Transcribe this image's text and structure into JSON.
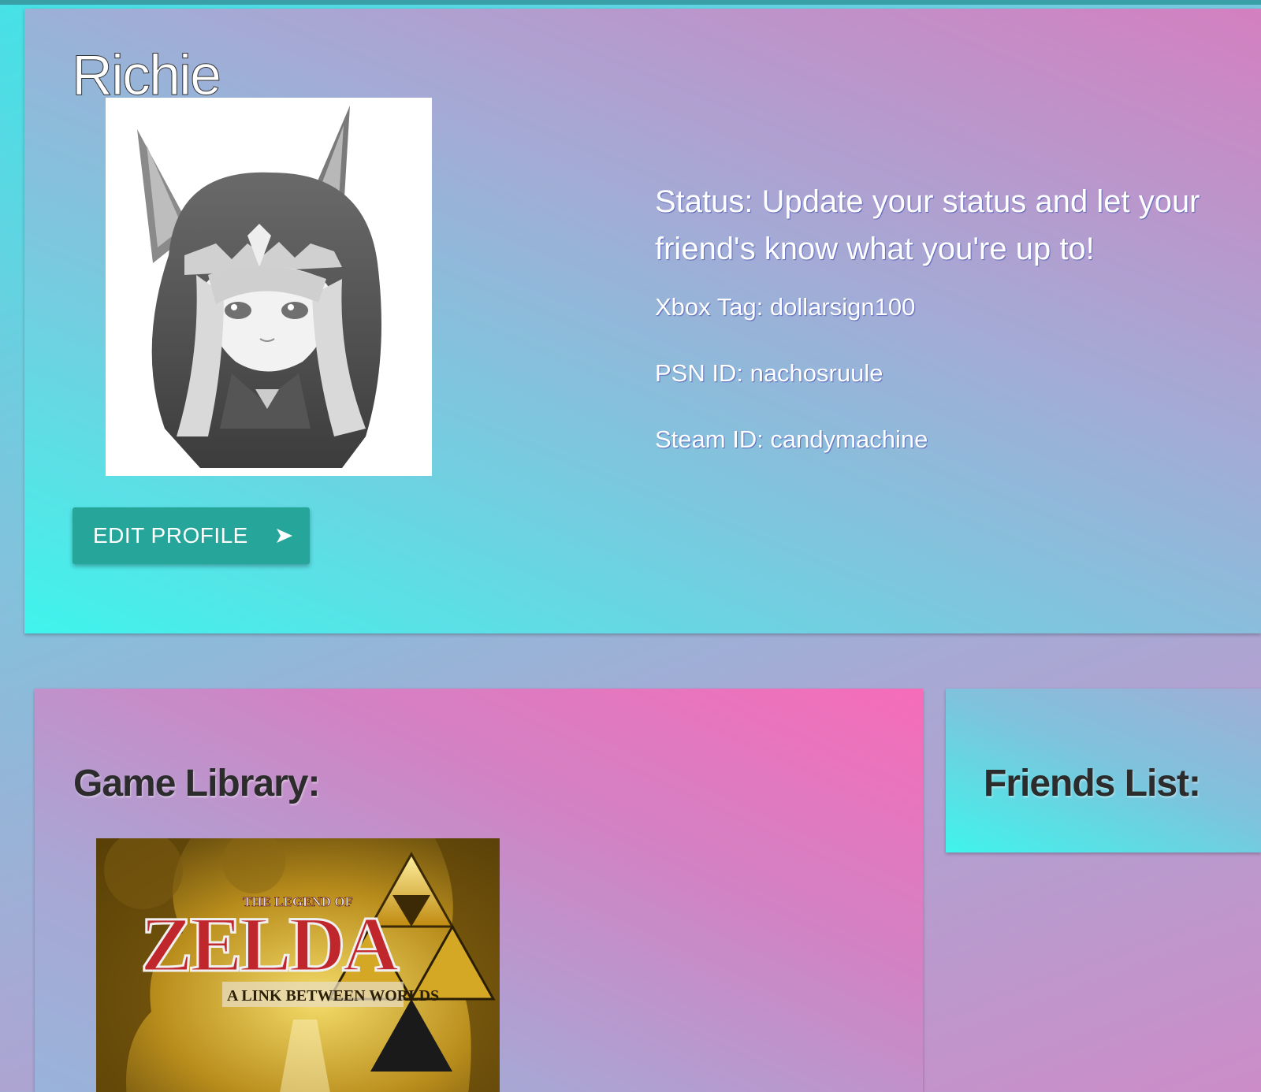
{
  "profile": {
    "username": "Richie",
    "edit_button_label": "EDIT PROFILE",
    "status": "Status: Update your status and let your friend's know what you're up to!",
    "xbox_tag": "Xbox Tag: dollarsign100",
    "psn_id": "PSN ID: nachosruule",
    "steam_id": "Steam ID: candymachine",
    "avatar_icon": "anime-character-avatar",
    "edit_icon": "send-arrow-icon"
  },
  "library": {
    "title": "Game Library:",
    "games": [
      {
        "cover_top_text": "THE LEGEND OF",
        "cover_title": "ZELDA",
        "cover_subtitle": "A LINK BETWEEN WORLDS"
      }
    ]
  },
  "friends": {
    "title": "Friends List:"
  },
  "colors": {
    "button": "#26a69a",
    "accent_cyan": "#3ff4ec",
    "accent_pink": "#f66cb9",
    "zelda_red": "#c0272d",
    "zelda_gold": "#e8b52c"
  }
}
